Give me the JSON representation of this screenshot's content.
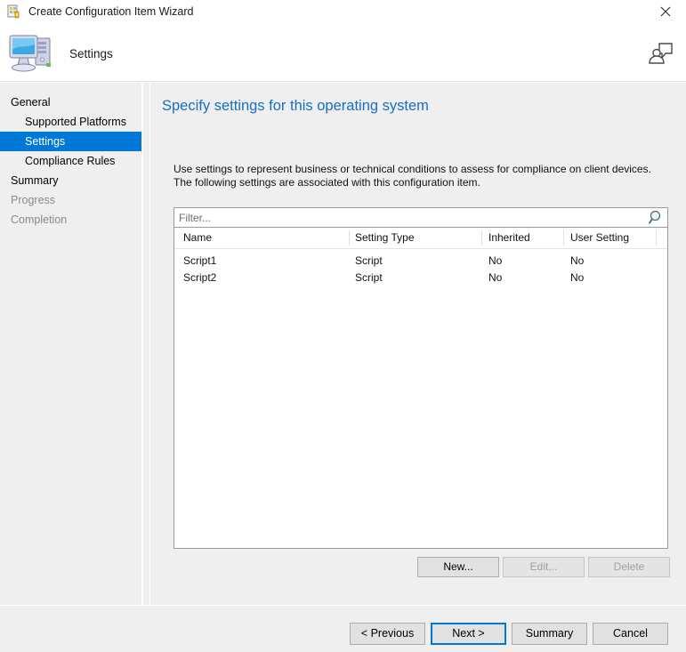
{
  "window": {
    "title": "Create Configuration Item Wizard",
    "title_icon": "configuration-item-icon",
    "close_icon": "close-icon"
  },
  "header": {
    "label": "Settings",
    "icon": "computer-icon",
    "help_icon": "help-person-icon"
  },
  "sidebar": {
    "items": [
      {
        "label": "General",
        "indent": false,
        "state": "normal"
      },
      {
        "label": "Supported Platforms",
        "indent": true,
        "state": "normal"
      },
      {
        "label": "Settings",
        "indent": true,
        "state": "selected"
      },
      {
        "label": "Compliance Rules",
        "indent": true,
        "state": "normal"
      },
      {
        "label": "Summary",
        "indent": false,
        "state": "normal"
      },
      {
        "label": "Progress",
        "indent": false,
        "state": "disabled"
      },
      {
        "label": "Completion",
        "indent": false,
        "state": "disabled"
      }
    ]
  },
  "main": {
    "heading": "Specify settings for this operating system",
    "description": "Use settings to represent business or technical conditions to assess for compliance on client devices. The following settings are associated with this configuration item.",
    "filter": {
      "value": "",
      "placeholder": "Filter...",
      "icon": "search-icon"
    },
    "table": {
      "columns": [
        "Name",
        "Setting Type",
        "Inherited",
        "User Setting"
      ],
      "rows": [
        {
          "name": "Script1",
          "setting_type": "Script",
          "inherited": "No",
          "user_setting": "No"
        },
        {
          "name": "Script2",
          "setting_type": "Script",
          "inherited": "No",
          "user_setting": "No"
        }
      ]
    },
    "item_buttons": [
      {
        "label": "New...",
        "enabled": true
      },
      {
        "label": "Edit...",
        "enabled": false
      },
      {
        "label": "Delete",
        "enabled": false
      }
    ]
  },
  "footer": {
    "buttons": [
      {
        "label": "< Previous",
        "default": false
      },
      {
        "label": "Next >",
        "default": true
      },
      {
        "label": "Summary",
        "default": false
      },
      {
        "label": "Cancel",
        "default": false
      }
    ]
  },
  "colors": {
    "accent": "#0078d7",
    "heading": "#1570c0",
    "chrome": "#efefef",
    "disabled_text": "#8a8a8a"
  }
}
